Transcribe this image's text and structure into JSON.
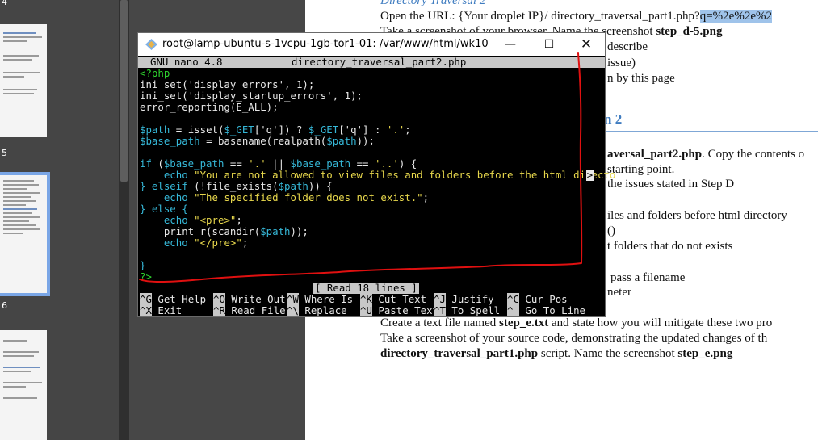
{
  "viewer": {
    "page_numbers": [
      "4",
      "5",
      "6"
    ]
  },
  "document": {
    "lines": [
      "Directory Traversal 2",
      "Open the URL: {Your droplet IP}/ directory_traversal_part1.php?",
      "q=%2e%2e%2",
      "Take a screenshot of your browser. Name the screenshot ",
      "step_d-5.png",
      "describe",
      "issue)",
      "n by this page",
      "n 2",
      "aversal_part2.php",
      ". Copy the contents o",
      "starting point.",
      "the issues stated in Step D",
      "iles and folders before html directory",
      "()",
      "t folders that do not exists",
      "pass a filename",
      "neter",
      "Create a text file named ",
      "step_e.txt",
      " and state how you will mitigate these two pro",
      "Take a screenshot of your source code, demonstrating the updated changes of th",
      "directory_traversal_part1.php",
      " script. Name the screenshot ",
      "step_e.png"
    ]
  },
  "terminal": {
    "title": "root@lamp-ubuntu-s-1vcpu-1gb-tor1-01: /var/www/html/wk10",
    "nano_version": "GNU nano 4.8",
    "filename": "directory_traversal_part2.php",
    "code": {
      "l1": "<?php",
      "l2": "ini_set('display_errors', 1);",
      "l3": "ini_set('display_startup_errors', 1);",
      "l4": "error_reporting(E_ALL);",
      "l6a": "$path",
      "l6b": " = isset(",
      "l6c": "$_GET",
      "l6d": "['q']) ? ",
      "l6e": "$_GET",
      "l6f": "['q'] : ",
      "l6g": "'.'",
      "l6h": ";",
      "l7a": "$base_path",
      "l7b": " = basename(realpath(",
      "l7c": "$path",
      "l7d": "));",
      "l9a": "if",
      "l9b": " (",
      "l9c": "$base_path",
      "l9d": " == ",
      "l9e": "'.'",
      "l9f": " || ",
      "l9g": "$base_path",
      "l9h": " == ",
      "l9i": "'..'",
      "l9j": ") {",
      "l10a": "    echo ",
      "l10b": "\"You are not allowed to view files and folders before the html directo",
      "l10c": ">",
      "l11a": "} elseif",
      "l11b": " (!file_exists(",
      "l11c": "$path",
      "l11d": ")) {",
      "l12a": "    echo ",
      "l12b": "\"The specified folder does not exist.\"",
      "l12c": ";",
      "l13": "} else {",
      "l14a": "    echo ",
      "l14b": "\"<pre>\"",
      "l14c": ";",
      "l15a": "    print_r(scandir(",
      "l15b": "$path",
      "l15c": "));",
      "l16a": "    echo ",
      "l16b": "\"</pre>\"",
      "l16c": ";",
      "l17": "}",
      "l18": "?>"
    },
    "status": "[ Read 18 lines ]",
    "shortcuts": [
      {
        "key": "^G",
        "label": "Get Help"
      },
      {
        "key": "^O",
        "label": "Write Out"
      },
      {
        "key": "^W",
        "label": "Where Is"
      },
      {
        "key": "^K",
        "label": "Cut Text"
      },
      {
        "key": "^J",
        "label": "Justify"
      },
      {
        "key": "^C",
        "label": "Cur Pos"
      },
      {
        "key": "^X",
        "label": "Exit"
      },
      {
        "key": "^R",
        "label": "Read File"
      },
      {
        "key": "^\\",
        "label": "Replace"
      },
      {
        "key": "^U",
        "label": "Paste Text"
      },
      {
        "key": "^T",
        "label": "To Spell"
      },
      {
        "key": "^_",
        "label": "Go To Line"
      }
    ]
  },
  "colors": {
    "annotation": "#e01010",
    "php_green": "#2fd42f",
    "var_cyan": "#36b8d8",
    "string_yellow": "#e8d84c",
    "heading_blue": "#3f7cc0"
  }
}
